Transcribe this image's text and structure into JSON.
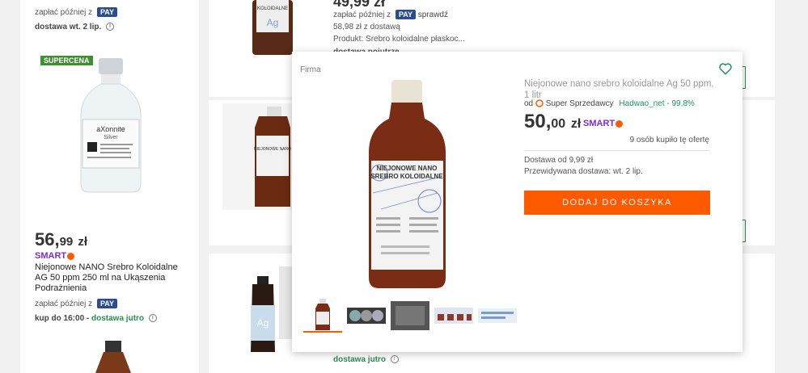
{
  "left_listing": {
    "pay_later_top": "zapłać później z",
    "pay_badge": "PAY",
    "delivery_top": "dostawa wt. 2 lip.",
    "supercena": "SUPERCENA",
    "price_main": "56,",
    "price_cents": "99",
    "price_currency": "zł",
    "smart": "SMART",
    "title": "Niejonowe NANO Srebro Koloidalne AG 50 ppm 250 ml na Ukąszenia Podrażnienia",
    "pay_later": "zapłać później z",
    "delivery_prefix": "kup do 16:00 - ",
    "delivery_highlight": "dostawa jutro"
  },
  "mid_listing_1": {
    "price_partial": "49,99 zł",
    "pay_later": "zapłać później z",
    "pay_badge": "PAY",
    "check": "sprawdź",
    "price_delivery": "58,98 zł z dostawą",
    "product": "Produkt: Srebro koloidalne płaskoc...",
    "delivery_partial": "dostawa pojutrze"
  },
  "mid_listing_3": {
    "delivery": "dostawa jutro"
  },
  "popup": {
    "firma": "Firma",
    "title": "Niejonowe nano srebro koloidalne Ag 50 ppm, 1 litr",
    "seller_prefix": "od",
    "seller_badge": "Super Sprzedawcy",
    "seller_name": "Hadwao_net - 99,8%",
    "price_main": "50,",
    "price_cents": "00",
    "price_currency": "zł",
    "smart": "SMART",
    "bought": "9 osób kupiło tę ofertę",
    "delivery_cost": "Dostawa od 9,99 zł",
    "delivery_estimate": "Przewidywana dostawa: wt. 2 lip.",
    "add_to_cart": "DODAJ DO KOSZYKA",
    "accent_color": "#ff5a00",
    "heart_icon": "heart-icon",
    "bottle_label_line1": "NIEJONOWE NANO",
    "bottle_label_line2": "SREBRO KOLOIDALNE"
  }
}
